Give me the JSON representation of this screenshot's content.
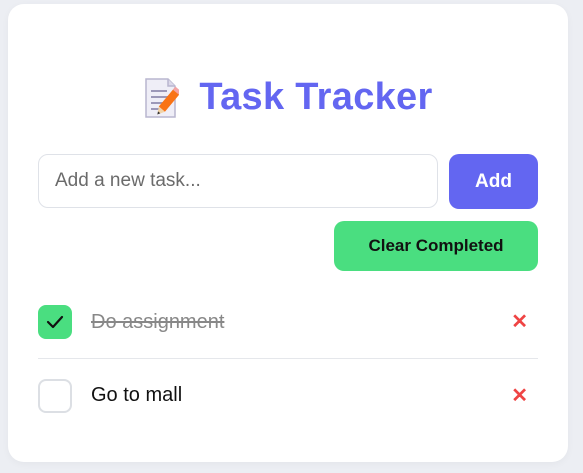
{
  "header": {
    "icon": "memo-icon",
    "title": "Task Tracker"
  },
  "form": {
    "input_placeholder": "Add a new task...",
    "input_value": "",
    "add_label": "Add"
  },
  "actions": {
    "clear_label": "Clear Completed"
  },
  "tasks": [
    {
      "text": "Do assignment",
      "completed": true
    },
    {
      "text": "Go to mall",
      "completed": false
    }
  ],
  "icons": {
    "check": "check-icon",
    "delete": "close-icon",
    "delete_glyph": "✕"
  },
  "colors": {
    "accent": "#6366f1",
    "success": "#4ade80",
    "danger": "#ef4444"
  }
}
